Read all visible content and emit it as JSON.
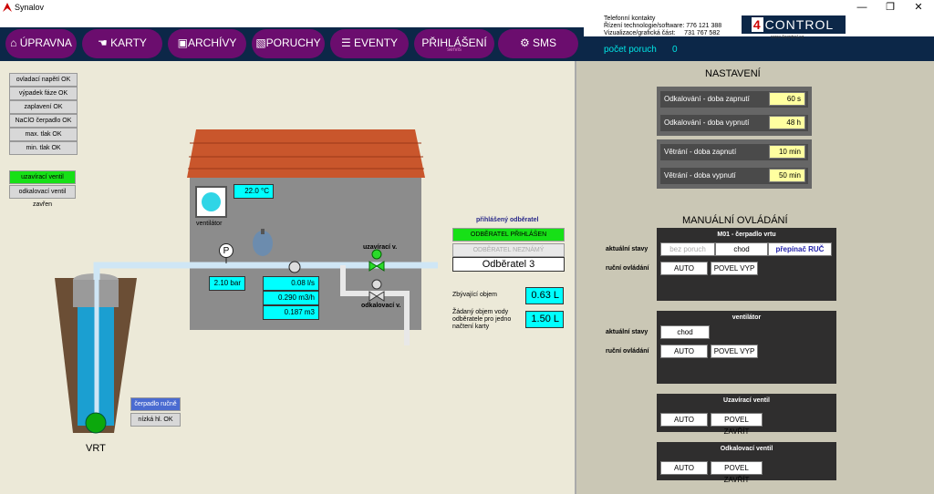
{
  "window": {
    "title": "Synalov",
    "min": "—",
    "max": "❐",
    "close": "✕"
  },
  "nav": [
    {
      "label": "ÚPRAVNA"
    },
    {
      "label": "KARTY"
    },
    {
      "label": "ARCHÍVY"
    },
    {
      "label": "PORUCHY"
    },
    {
      "label": "EVENTY"
    },
    {
      "label": "PŘIHLÁŠENÍ",
      "sub": "servis"
    },
    {
      "label": "SMS"
    }
  ],
  "contacts": {
    "l1": "Telefonní kontakty",
    "l2": "Řízení technologie/software: 776 121 388",
    "l3": "Vizualizace/grafická část:     731 767 582"
  },
  "logo": {
    "prefix": "4",
    "text": "CONTROL",
    "url": "www.4control.cz"
  },
  "faults": {
    "label": "počet poruch",
    "value": "0"
  },
  "status": [
    "ovladací napětí OK",
    "výpadek fáze OK",
    "zaplavení OK",
    "NaClO čerpadlo OK",
    "max. tlak OK",
    "min. tlak OK"
  ],
  "valves": {
    "open": "uzavírací ventil otevřen",
    "closed": "odkalovací ventil zavřen"
  },
  "house": {
    "temp": "22.0 °C",
    "vent_label": "ventilátor",
    "pressure": "2.10 bar",
    "flow1": "0.08 l/s",
    "flow2": "0.290 m3/h",
    "flow3": "0.187 m3",
    "valve1": "uzavírací v.",
    "valve2": "odkalovací v.",
    "pump_symbol": "P"
  },
  "consumer": {
    "title": "přihlášený odběratel",
    "logged": "ODBĚRATEL PŘIHLÁŠEN",
    "unknown": "ODBĚRATEL NEZNÁMÝ",
    "name": "Odběratel 3",
    "remain_label": "Zbývající objem",
    "remain_value": "0.63 L",
    "req_label": "Žádaný objem vody odběratele pro jedno načtení karty",
    "req_value": "1.50 L"
  },
  "well": {
    "pump_manual": "čerpadlo ručně",
    "low_level": "nízká hl. OK",
    "label": "VRT"
  },
  "settings": {
    "title": "NASTAVENÍ",
    "rows": [
      {
        "label": "Odkalování - doba zapnutí",
        "value": "60 s"
      },
      {
        "label": "Odkalování - doba vypnutí",
        "value": "48 h"
      },
      {
        "label": "Větrání - doba zapnutí",
        "value": "10 min"
      },
      {
        "label": "Větrání - doba vypnutí",
        "value": "50 min"
      }
    ]
  },
  "manual": {
    "title": "MANUÁLNÍ OVLÁDÁNÍ",
    "state_label": "aktuální stavy",
    "control_label": "ruční ovládání",
    "pump": {
      "title": "M01 - čerpadlo vrtu",
      "s1": "bez poruch",
      "s2": "chod",
      "s3": "přepínač RUČ",
      "b1": "AUTO",
      "b2": "POVEL VYP"
    },
    "vent": {
      "title": "ventilátor",
      "s1": "chod",
      "b1": "AUTO",
      "b2": "POVEL VYP"
    },
    "valve1": {
      "title": "Uzavírací ventil",
      "b1": "AUTO",
      "b2": "POVEL ZAVŘÍT"
    },
    "valve2": {
      "title": "Odkalovací ventil",
      "b1": "AUTO",
      "b2": "POVEL ZAVŘÍT"
    }
  }
}
